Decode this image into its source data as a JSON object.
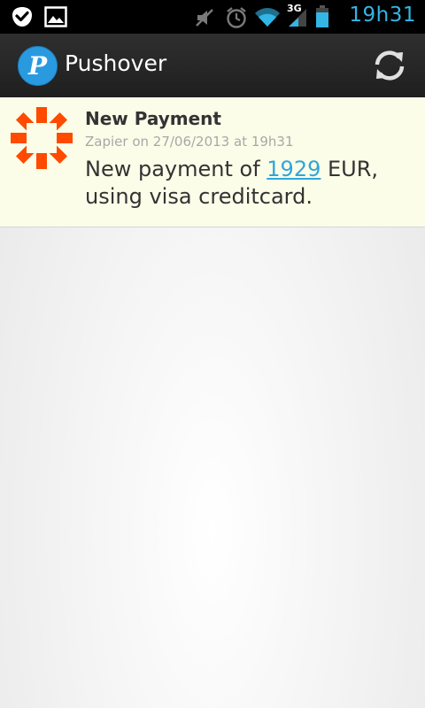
{
  "status_bar": {
    "time": "19h31",
    "network_type": "3G",
    "left_icons": [
      "checkmark-notification-icon",
      "image-notification-icon"
    ],
    "right_icons": [
      "muted-speaker-icon",
      "alarm-clock-icon",
      "wifi-icon",
      "signal-icon",
      "battery-icon"
    ],
    "accent_color": "#33b5e5"
  },
  "action_bar": {
    "title": "Pushover",
    "logo_letter": "P",
    "logo_color": "#2a9ae0",
    "refresh_icon": "refresh-icon"
  },
  "messages": [
    {
      "icon": "zapier-icon",
      "icon_color": "#ff4a00",
      "title": "New Payment",
      "meta": "Zapier on 27/06/2013 at 19h31",
      "body_before": "New payment of ",
      "body_link": "1929",
      "body_after": " EUR, using visa creditcard.",
      "background": "#fbfde8"
    }
  ]
}
